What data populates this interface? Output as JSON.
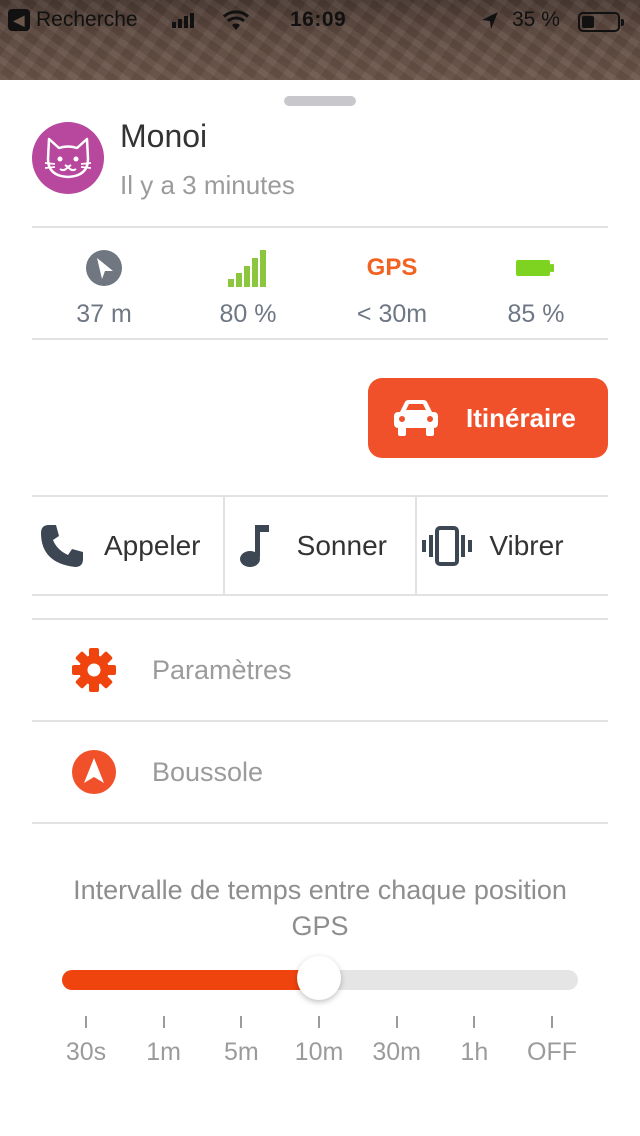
{
  "status_bar": {
    "back_label": "Recherche",
    "time": "16:09",
    "battery_pct": "35 %"
  },
  "device": {
    "name": "Monoi",
    "last_seen": "Il y a 3 minutes",
    "avatar_icon": "cat-icon",
    "avatar_color": "#b8479e"
  },
  "stats": [
    {
      "icon": "navigation-arrow-icon",
      "value": "37 m"
    },
    {
      "icon": "signal-bars-icon",
      "value": "80 %"
    },
    {
      "icon": "gps-label",
      "label": "GPS",
      "value": "< 30m"
    },
    {
      "icon": "battery-icon",
      "value": "85 %"
    }
  ],
  "route_button": {
    "label": "Itinéraire",
    "icon": "car-icon",
    "color": "#f0512a"
  },
  "actions": [
    {
      "label": "Appeler",
      "icon": "phone-icon"
    },
    {
      "label": "Sonner",
      "icon": "music-note-icon"
    },
    {
      "label": "Vibrer",
      "icon": "vibrate-icon"
    }
  ],
  "menu": [
    {
      "label": "Paramètres",
      "icon": "gear-icon"
    },
    {
      "label": "Boussole",
      "icon": "compass-icon"
    }
  ],
  "interval": {
    "title": "Intervalle de temps entre chaque position GPS",
    "options": [
      "30s",
      "1m",
      "5m",
      "10m",
      "30m",
      "1h",
      "OFF"
    ],
    "selected": "10m",
    "selected_index": 3,
    "accent": "#f0440f"
  }
}
